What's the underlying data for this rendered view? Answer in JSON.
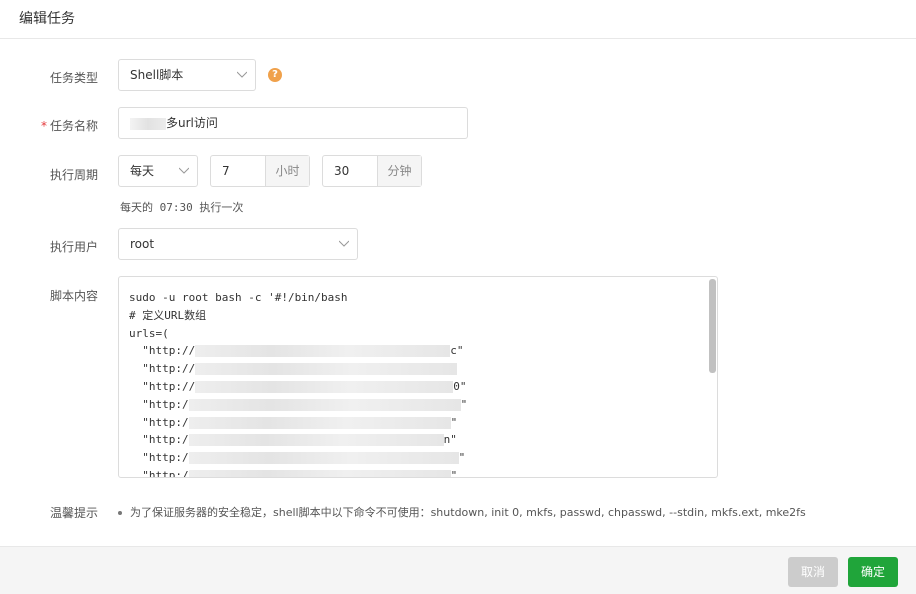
{
  "dialog": {
    "title": "编辑任务"
  },
  "form": {
    "task_type": {
      "label": "任务类型",
      "value": "Shell脚本",
      "help": "?"
    },
    "task_name": {
      "label": "任务名称",
      "required_mark": "*",
      "value": "多url访问"
    },
    "period": {
      "label": "执行周期",
      "frequency": "每天",
      "hour": "7",
      "hour_unit": "小时",
      "minute": "30",
      "minute_unit": "分钟",
      "hint": "每天的 07:30 执行一次"
    },
    "user": {
      "label": "执行用户",
      "value": "root"
    },
    "script": {
      "label": "脚本内容",
      "lines": [
        "sudo -u root bash -c '#!/bin/bash",
        "# 定义URL数组",
        "urls=(",
        "  \"http://",
        "  \"http://",
        "  \"http://",
        "  \"http:/",
        "  \"http:/",
        "  \"http:/",
        "  \"http:/",
        "  \"http:/"
      ],
      "line_ends": [
        "",
        "",
        "",
        "c\"",
        "",
        "0\"",
        "\"",
        "\"",
        "n\"",
        "\"",
        "\""
      ]
    },
    "tips": {
      "label": "温馨提示",
      "text": "为了保证服务器的安全稳定，shell脚本中以下命令不可使用：shutdown, init 0, mkfs, passwd, chpasswd, --stdin, mkfs.ext, mke2fs"
    }
  },
  "footer": {
    "cancel_label": "取消",
    "confirm_label": "确定"
  },
  "colors": {
    "confirm": "#20a53a",
    "cancel": "#cccccc",
    "help": "#f0a14b",
    "required": "#e4393c"
  }
}
